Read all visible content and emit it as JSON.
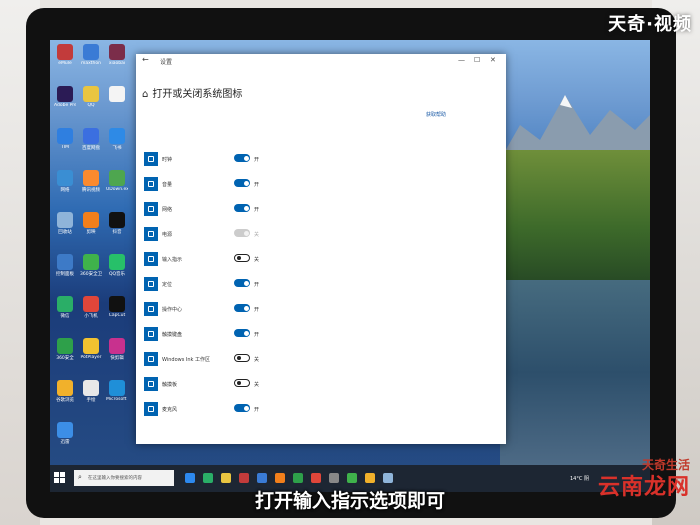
{
  "watermark": "天奇·视频",
  "caption": "打开输入指示选项即可",
  "brand": {
    "line1": "天奇生活",
    "line2": "云南龙网"
  },
  "desktop_icons": [
    {
      "label": "eMule",
      "color": "#c23b3b"
    },
    {
      "label": "maxthon",
      "color": "#3a7bd5"
    },
    {
      "label": "xiaobai",
      "color": "#7b2d4a"
    },
    {
      "label": "Adobe Premie...",
      "color": "#2b1b55"
    },
    {
      "label": "QQ",
      "color": "#e9c541"
    },
    {
      "label": "",
      "color": "#f4f4f4"
    },
    {
      "label": "TIM",
      "color": "#2f7fe0"
    },
    {
      "label": "百度网盘",
      "color": "#3b6fe0"
    },
    {
      "label": "飞书",
      "color": "#2e8ae6"
    },
    {
      "label": "网络",
      "color": "#3a8ed3"
    },
    {
      "label": "腾讯视频",
      "color": "#fb8a2e"
    },
    {
      "label": "UDown.exe",
      "color": "#4ea64f"
    },
    {
      "label": "回收站",
      "color": "#8fb4d9"
    },
    {
      "label": "剪映",
      "color": "#f27f1b"
    },
    {
      "label": "抖音",
      "color": "#111111"
    },
    {
      "label": "控制面板",
      "color": "#3d7ac7"
    },
    {
      "label": "360安全卫士",
      "color": "#3fb24b"
    },
    {
      "label": "QQ音乐",
      "color": "#27c069"
    },
    {
      "label": "微信",
      "color": "#2aae67"
    },
    {
      "label": "小飞机",
      "color": "#e0463a"
    },
    {
      "label": "CapCut",
      "color": "#111111"
    },
    {
      "label": "360安全",
      "color": "#2ea04a"
    },
    {
      "label": "PotPlayer",
      "color": "#f2c230"
    },
    {
      "label": "快剪辑",
      "color": "#c8318e"
    },
    {
      "label": "谷歌浏览",
      "color": "#f1b12b"
    },
    {
      "label": "手绘",
      "color": "#e8e8e8"
    },
    {
      "label": "Microsoft Edge",
      "color": "#1f8fd8"
    },
    {
      "label": "迅雷",
      "color": "#3c8ee6"
    }
  ],
  "settings_window": {
    "title": "设置",
    "back_icon": "back-arrow-icon",
    "heading": "打开或关闭系统图标",
    "home_icon": "home-icon",
    "controls": {
      "minimize": "—",
      "maximize": "☐",
      "close": "✕"
    },
    "help_link": "获取帮助",
    "rows": [
      {
        "name": "时钟",
        "state": "on",
        "label": "开"
      },
      {
        "name": "音量",
        "state": "on",
        "label": "开"
      },
      {
        "name": "网络",
        "state": "on",
        "label": "开"
      },
      {
        "name": "电源",
        "state": "disabled",
        "label": "关"
      },
      {
        "name": "输入指示",
        "state": "off",
        "label": "关"
      },
      {
        "name": "定位",
        "state": "on",
        "label": "开"
      },
      {
        "name": "操作中心",
        "state": "on",
        "label": "开"
      },
      {
        "name": "触摸键盘",
        "state": "on",
        "label": "开"
      },
      {
        "name": "Windows Ink 工作区",
        "state": "off",
        "label": "关"
      },
      {
        "name": "触摸板",
        "state": "off",
        "label": "关"
      },
      {
        "name": "麦克风",
        "state": "on",
        "label": "开"
      }
    ]
  },
  "taskbar": {
    "search_placeholder": "在这里输入你要搜索的内容",
    "tray_weather": "14°C 阴",
    "clock_time": "",
    "clock_date": "",
    "pinned_colors": [
      "#2d89ef",
      "#2aae67",
      "#e9c541",
      "#c23b3b",
      "#3a7bd5",
      "#f27f1b",
      "#2ea04a",
      "#e0463a",
      "#888888",
      "#3fb24b",
      "#f1b12b",
      "#8fb4d9"
    ]
  }
}
